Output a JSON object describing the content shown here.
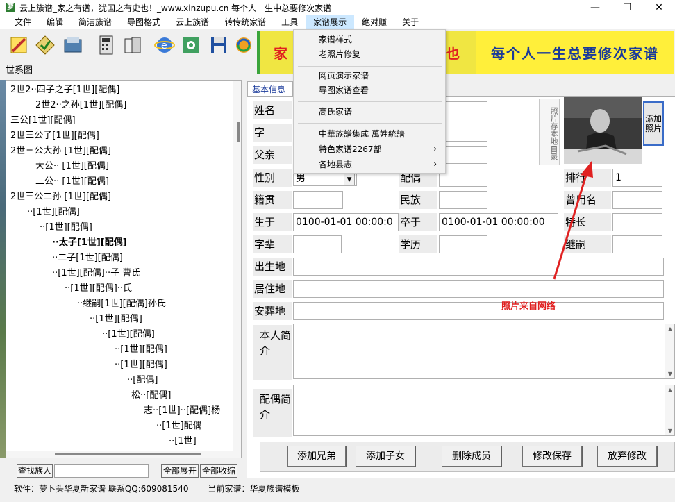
{
  "window": {
    "title": "云上族谱_家之有谱，犹国之有史也！_www.xinzupu.cn 每个人一生中总要修次家谱",
    "icon_text": "萝"
  },
  "menu": [
    "文件",
    "编辑",
    "简洁族谱",
    "导图格式",
    "云上族谱",
    "转传统家谱",
    "工具",
    "家谱展示",
    "绝对赚",
    "关于"
  ],
  "banner": {
    "left_text": "家",
    "left_tail": "也",
    "right_text": "每个人一生总要修次家谱"
  },
  "left_panel": {
    "title": "世系图",
    "tree": [
      {
        "text": "2世2··四子之子[1世][配偶]",
        "bold": false
      },
      {
        "text": "2世2··之孙[1世][配偶]",
        "bold": false
      },
      {
        "text": "三公[1世][配偶]",
        "bold": false
      },
      {
        "text": "2世三公子[1世][配偶]",
        "bold": false
      },
      {
        "text": "2世三公大孙 [1世][配偶]",
        "bold": false
      },
      {
        "text": "大公··    [1世][配偶]",
        "bold": false
      },
      {
        "text": "二公·· [1世][配偶]",
        "bold": false
      },
      {
        "text": "2世三公二孙 [1世][配偶]",
        "bold": false
      },
      {
        "text": "··[1世][配偶]",
        "bold": false
      },
      {
        "text": "··[1世][配偶]",
        "bold": false
      },
      {
        "text": "··太子[1世][配偶]",
        "bold": true
      },
      {
        "text": "··二子[1世][配偶]",
        "bold": false
      },
      {
        "text": "··[1世][配偶]··子 曹氏",
        "bold": false
      },
      {
        "text": "··[1世][配偶]··氏",
        "bold": false
      },
      {
        "text": "··继嗣[1世][配偶]孙氏",
        "bold": false
      },
      {
        "text": "··[1世][配偶]",
        "bold": false
      },
      {
        "text": "··[1世][配偶]",
        "bold": false
      },
      {
        "text": "··[1世][配偶]",
        "bold": false
      },
      {
        "text": "··[1世][配偶]",
        "bold": false
      },
      {
        "text": "··[配偶]",
        "bold": false
      },
      {
        "text": "松··[配偶]",
        "bold": false
      },
      {
        "text": "志··[1世]··[配偶]杨",
        "bold": false
      },
      {
        "text": "··[1世]配偶",
        "bold": false
      },
      {
        "text": "··[1世]",
        "bold": false
      }
    ],
    "find_label": "查找族人",
    "expand_all": "全部展开",
    "collapse_all": "全部收缩"
  },
  "status": {
    "software": "软件：萝卜头华夏新家谱 联系QQ:609081540",
    "current": "当前家谱：华夏族谱模板"
  },
  "form": {
    "tab": "基本信息",
    "labels": {
      "name": "姓名",
      "zi": "字",
      "father": "父亲",
      "gender": "性别",
      "spouse": "配偶",
      "rank": "排行",
      "native": "籍贯",
      "ethnic": "民族",
      "former_name": "曾用名",
      "born": "生于",
      "died": "卒于",
      "specialty": "特长",
      "generation": "字辈",
      "education": "学历",
      "heir": "继嗣",
      "birthplace": "出生地",
      "residence": "居住地",
      "burial": "安葬地",
      "bio": "本人简介",
      "spouse_bio": "配偶简介"
    },
    "values": {
      "gender": "男",
      "rank": "1",
      "born": "0100-01-01 00:00:0",
      "died": "0100-01-01 00:00:00"
    },
    "photo_label": "照片存本地目录",
    "add_photo": "添加照片",
    "annotation": "照片来自网络",
    "buttons": [
      "添加兄弟",
      "添加子女",
      "删除成员",
      "修改保存",
      "放弃修改"
    ]
  },
  "dropdown": {
    "items": [
      {
        "label": "家谱样式",
        "arrow": false
      },
      {
        "label": "老照片修复",
        "arrow": false
      },
      {
        "label": "网页演示家谱",
        "arrow": false
      },
      {
        "label": "导图家谱查看",
        "arrow": false
      },
      {
        "label": "高氏家谱",
        "arrow": false
      },
      {
        "label": "中華族譜集成 萬姓統譜",
        "arrow": false
      },
      {
        "label": "特色家谱2267部",
        "arrow": true
      },
      {
        "label": "各地县志",
        "arrow": true
      }
    ]
  },
  "colors": {
    "banner_yellow": "#f0e642",
    "banner_text_red": "#e02020",
    "banner_text_blue": "#1a3a9a",
    "annotation_red": "#e02020"
  }
}
